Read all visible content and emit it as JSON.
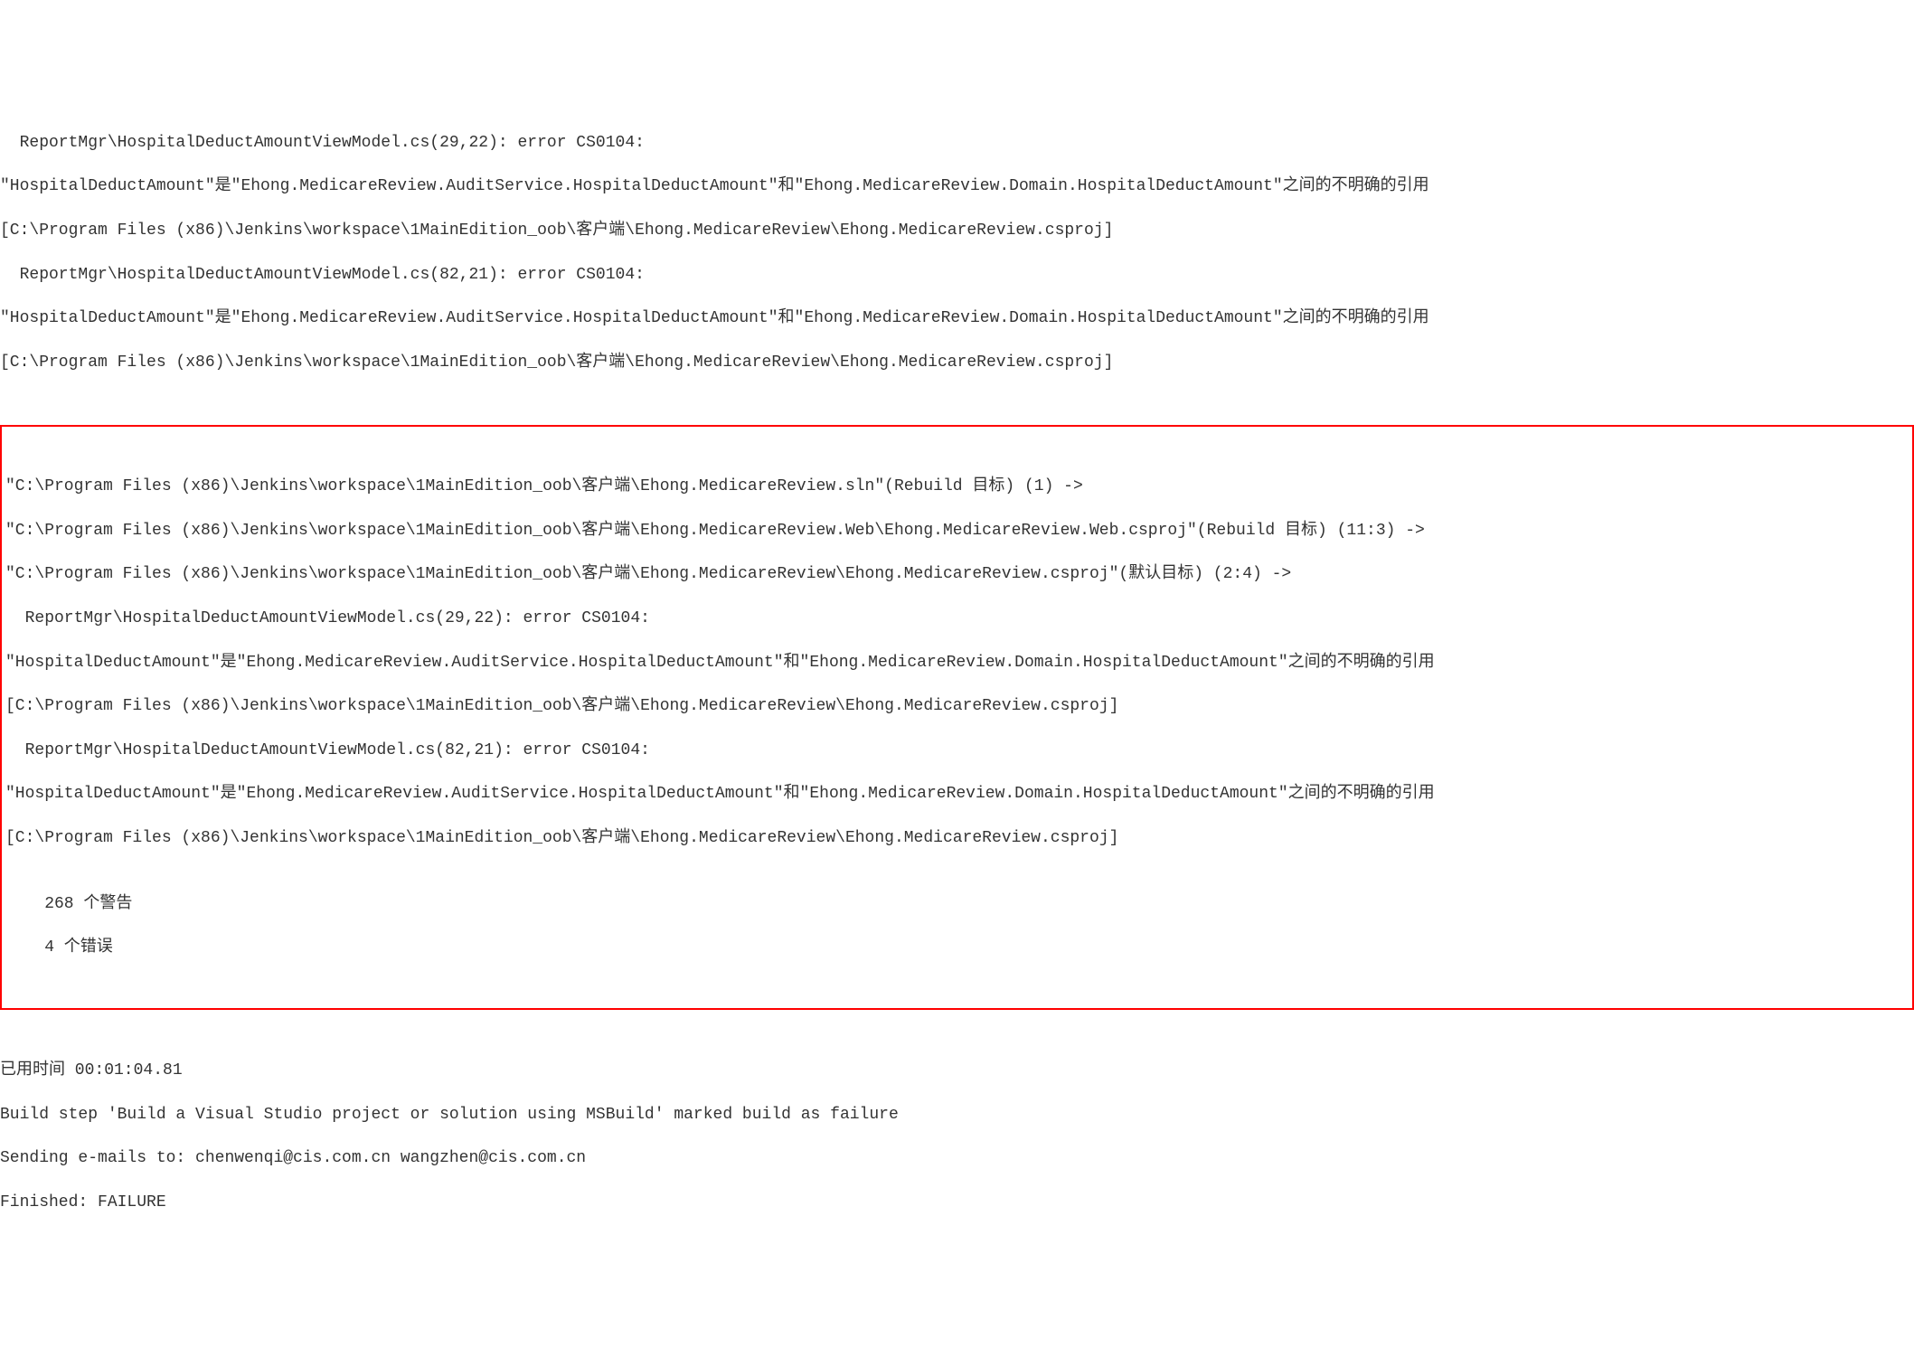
{
  "upper_block": {
    "lines": [
      "  ReportMgr\\HospitalDeductAmountViewModel.cs(29,22): error CS0104:",
      "\"HospitalDeductAmount\"是\"Ehong.MedicareReview.AuditService.HospitalDeductAmount\"和\"Ehong.MedicareReview.Domain.HospitalDeductAmount\"之间的不明确的引用",
      "[C:\\Program Files (x86)\\Jenkins\\workspace\\1MainEdition_oob\\客户端\\Ehong.MedicareReview\\Ehong.MedicareReview.csproj]",
      "  ReportMgr\\HospitalDeductAmountViewModel.cs(82,21): error CS0104:",
      "\"HospitalDeductAmount\"是\"Ehong.MedicareReview.AuditService.HospitalDeductAmount\"和\"Ehong.MedicareReview.Domain.HospitalDeductAmount\"之间的不明确的引用",
      "[C:\\Program Files (x86)\\Jenkins\\workspace\\1MainEdition_oob\\客户端\\Ehong.MedicareReview\\Ehong.MedicareReview.csproj]"
    ]
  },
  "highlighted_block": {
    "lines": [
      "",
      "\"C:\\Program Files (x86)\\Jenkins\\workspace\\1MainEdition_oob\\客户端\\Ehong.MedicareReview.sln\"(Rebuild 目标) (1) ->",
      "\"C:\\Program Files (x86)\\Jenkins\\workspace\\1MainEdition_oob\\客户端\\Ehong.MedicareReview.Web\\Ehong.MedicareReview.Web.csproj\"(Rebuild 目标) (11:3) ->",
      "\"C:\\Program Files (x86)\\Jenkins\\workspace\\1MainEdition_oob\\客户端\\Ehong.MedicareReview\\Ehong.MedicareReview.csproj\"(默认目标) (2:4) ->",
      "  ReportMgr\\HospitalDeductAmountViewModel.cs(29,22): error CS0104:",
      "\"HospitalDeductAmount\"是\"Ehong.MedicareReview.AuditService.HospitalDeductAmount\"和\"Ehong.MedicareReview.Domain.HospitalDeductAmount\"之间的不明确的引用",
      "[C:\\Program Files (x86)\\Jenkins\\workspace\\1MainEdition_oob\\客户端\\Ehong.MedicareReview\\Ehong.MedicareReview.csproj]",
      "  ReportMgr\\HospitalDeductAmountViewModel.cs(82,21): error CS0104:",
      "\"HospitalDeductAmount\"是\"Ehong.MedicareReview.AuditService.HospitalDeductAmount\"和\"Ehong.MedicareReview.Domain.HospitalDeductAmount\"之间的不明确的引用",
      "[C:\\Program Files (x86)\\Jenkins\\workspace\\1MainEdition_oob\\客户端\\Ehong.MedicareReview\\Ehong.MedicareReview.csproj]",
      "",
      "    268 个警告",
      "    4 个错误",
      ""
    ]
  },
  "footer_block": {
    "lines": [
      "已用时间 00:01:04.81",
      "Build step 'Build a Visual Studio project or solution using MSBuild' marked build as failure",
      "Sending e-mails to: chenwenqi@cis.com.cn wangzhen@cis.com.cn",
      "Finished: FAILURE"
    ]
  }
}
